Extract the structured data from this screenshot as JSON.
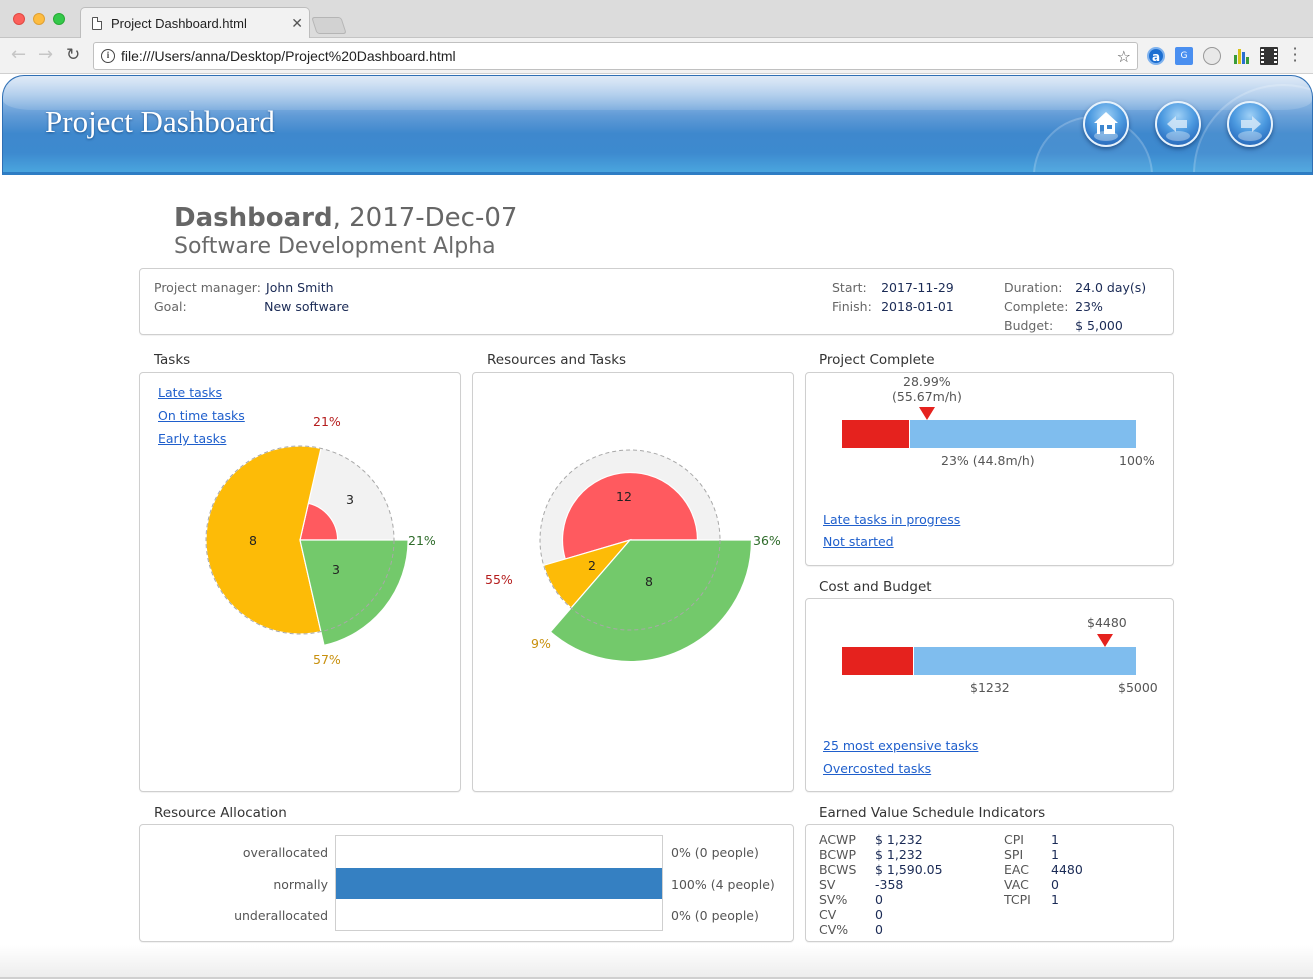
{
  "browser": {
    "tab_title": "Project Dashboard.html",
    "tab_close": "✕",
    "url": "file:///Users/anna/Desktop/Project%20Dashboard.html",
    "back_icon": "←",
    "forward_icon": "→",
    "reload_icon": "↻",
    "info_icon": "i",
    "star_icon": "☆",
    "extensions": [
      "a",
      "G",
      "chat",
      "chart",
      "film"
    ],
    "menu_icon": "⋮"
  },
  "banner": {
    "title": "Project Dashboard",
    "buttons": [
      "home",
      "back",
      "forward"
    ]
  },
  "header": {
    "title_bold": "Dashboard",
    "title_rest": ", 2017-Dec-07",
    "subtitle": "Software Development Alpha"
  },
  "summary": {
    "manager_label": "Project manager:",
    "manager": "John Smith",
    "goal_label": "Goal:",
    "goal": "New software",
    "start_label": "Start:",
    "start": "2017-11-29",
    "finish_label": "Finish:",
    "finish": "2018-01-01",
    "duration_label": "Duration:",
    "duration": "24.0 day(s)",
    "complete_label": "Complete:",
    "complete": "23%",
    "budget_label": "Budget:",
    "budget": "$ 5,000"
  },
  "tasks": {
    "title": "Tasks",
    "links": [
      "Late tasks",
      "On time tasks",
      "Early tasks"
    ]
  },
  "resources": {
    "title": "Resources and Tasks"
  },
  "project_complete": {
    "title": "Project Complete",
    "marker_label_1": "28.99%",
    "marker_label_2": "(55.67m/h)",
    "current_label": "23% (44.8m/h)",
    "max_label": "100%",
    "links": [
      "Late tasks in progress",
      "Not started"
    ]
  },
  "cost_budget": {
    "title": "Cost and Budget",
    "marker_label": "$4480",
    "current_label": "$1232",
    "max_label": "$5000",
    "links": [
      "25 most expensive tasks",
      "Overcosted tasks"
    ]
  },
  "resource_allocation": {
    "title": "Resource Allocation",
    "rows": [
      {
        "label": "overallocated",
        "value": "0% (0 people)"
      },
      {
        "label": "normally",
        "value": "100% (4 people)"
      },
      {
        "label": "underallocated",
        "value": "0% (0 people)"
      }
    ]
  },
  "earned_value": {
    "title": "Earned Value Schedule Indicators",
    "left": [
      {
        "label": "ACWP",
        "value": "$ 1,232"
      },
      {
        "label": "BCWP",
        "value": "$ 1,232"
      },
      {
        "label": "BCWS",
        "value": "$ 1,590.05"
      },
      {
        "label": "SV",
        "value": "-358"
      },
      {
        "label": "SV%",
        "value": "0"
      },
      {
        "label": "CV",
        "value": "0"
      },
      {
        "label": "CV%",
        "value": "0"
      }
    ],
    "right": [
      {
        "label": "CPI",
        "value": "1"
      },
      {
        "label": "SPI",
        "value": "1"
      },
      {
        "label": "EAC",
        "value": "4480"
      },
      {
        "label": "VAC",
        "value": "0"
      },
      {
        "label": "TCPI",
        "value": "1"
      }
    ]
  },
  "colors": {
    "red": "#ff5a5f",
    "yellow": "#fdbb07",
    "green": "#73c96b",
    "grey_bg": "#f2f2f2",
    "bar_red": "#e5221e",
    "bar_blue": "#7fbdee",
    "alloc_blue": "#3580c2",
    "link": "#1f5fcc",
    "pct_red": "#b51d1d",
    "pct_yellow": "#c8900d",
    "pct_green": "#2e6b2a"
  },
  "chart_data": [
    {
      "type": "pie",
      "title": "Tasks",
      "categories": [
        "Late tasks",
        "Early tasks",
        "On time tasks"
      ],
      "values": [
        3,
        8,
        3
      ],
      "percent_labels": [
        "21%",
        "57%",
        "21%"
      ],
      "relative_radius": [
        0.4,
        1.0,
        1.15
      ],
      "colors": [
        "#ff5a5f",
        "#fdbb07",
        "#73c96b"
      ]
    },
    {
      "type": "pie",
      "title": "Resources and Tasks",
      "categories": [
        "Late",
        "Early",
        "On time"
      ],
      "values": [
        12,
        2,
        8
      ],
      "percent_labels": [
        "55%",
        "9%",
        "36%"
      ],
      "relative_radius": [
        0.75,
        1.0,
        1.35
      ],
      "colors": [
        "#ff5a5f",
        "#fdbb07",
        "#73c96b"
      ]
    },
    {
      "type": "bar",
      "title": "Project Complete",
      "current_percent": 23,
      "marker_percent": 28.99,
      "max_percent": 100
    },
    {
      "type": "bar",
      "title": "Cost and Budget",
      "current_value": 1232,
      "marker_value": 4480,
      "max_value": 5000
    },
    {
      "type": "bar",
      "title": "Resource Allocation",
      "categories": [
        "overallocated",
        "normally",
        "underallocated"
      ],
      "values": [
        0,
        100,
        0
      ],
      "unit": "%"
    }
  ]
}
